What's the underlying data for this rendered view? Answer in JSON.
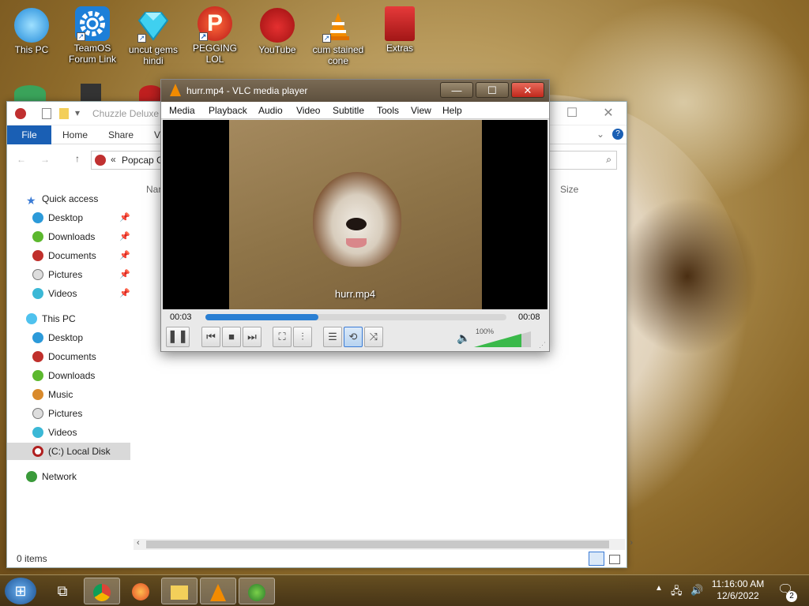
{
  "desktop": {
    "icons": [
      {
        "label": "This PC",
        "icon": "computer-icon"
      },
      {
        "label": "TeamOS Forum Link",
        "icon": "gear-icon"
      },
      {
        "label": "uncut gems hindi",
        "icon": "gem-icon"
      },
      {
        "label": "PEGGING LOL",
        "icon": "peggle-icon"
      },
      {
        "label": "YouTube",
        "icon": "angry-bird-icon"
      },
      {
        "label": "cum stained cone",
        "icon": "vlc-cone-icon"
      },
      {
        "label": "Extras",
        "icon": "extras-book-icon"
      }
    ]
  },
  "explorer": {
    "title": "Chuzzle Deluxe",
    "ribbon": {
      "file": "File",
      "home": "Home",
      "share": "Share",
      "view": "V"
    },
    "address": {
      "path": "Popcap G",
      "chevrons": "«"
    },
    "column_name": "Nar",
    "column_size": "Size",
    "nav": {
      "quick_access": "Quick access",
      "quick_items": [
        "Desktop",
        "Downloads",
        "Documents",
        "Pictures",
        "Videos"
      ],
      "this_pc": "This PC",
      "pc_items": [
        "Desktop",
        "Documents",
        "Downloads",
        "Music",
        "Pictures",
        "Videos",
        "(C:) Local Disk"
      ],
      "network": "Network"
    },
    "status": "0 items"
  },
  "vlc": {
    "title": "hurr.mp4 - VLC media player",
    "menu": [
      "Media",
      "Playback",
      "Audio",
      "Video",
      "Subtitle",
      "Tools",
      "View",
      "Help"
    ],
    "video_caption": "hurr.mp4",
    "time_elapsed": "00:03",
    "time_total": "00:08",
    "progress": 0.375,
    "volume": "100%"
  },
  "taskbar": {
    "clock_time": "11:16:00 AM",
    "clock_date": "12/6/2022",
    "notifications": "2"
  },
  "colors": {
    "accent": "#1a5fb4",
    "seek_fill": "#2a7fd3",
    "volume_fill": "#3ab94a",
    "vlc_orange": "#f28b00"
  }
}
